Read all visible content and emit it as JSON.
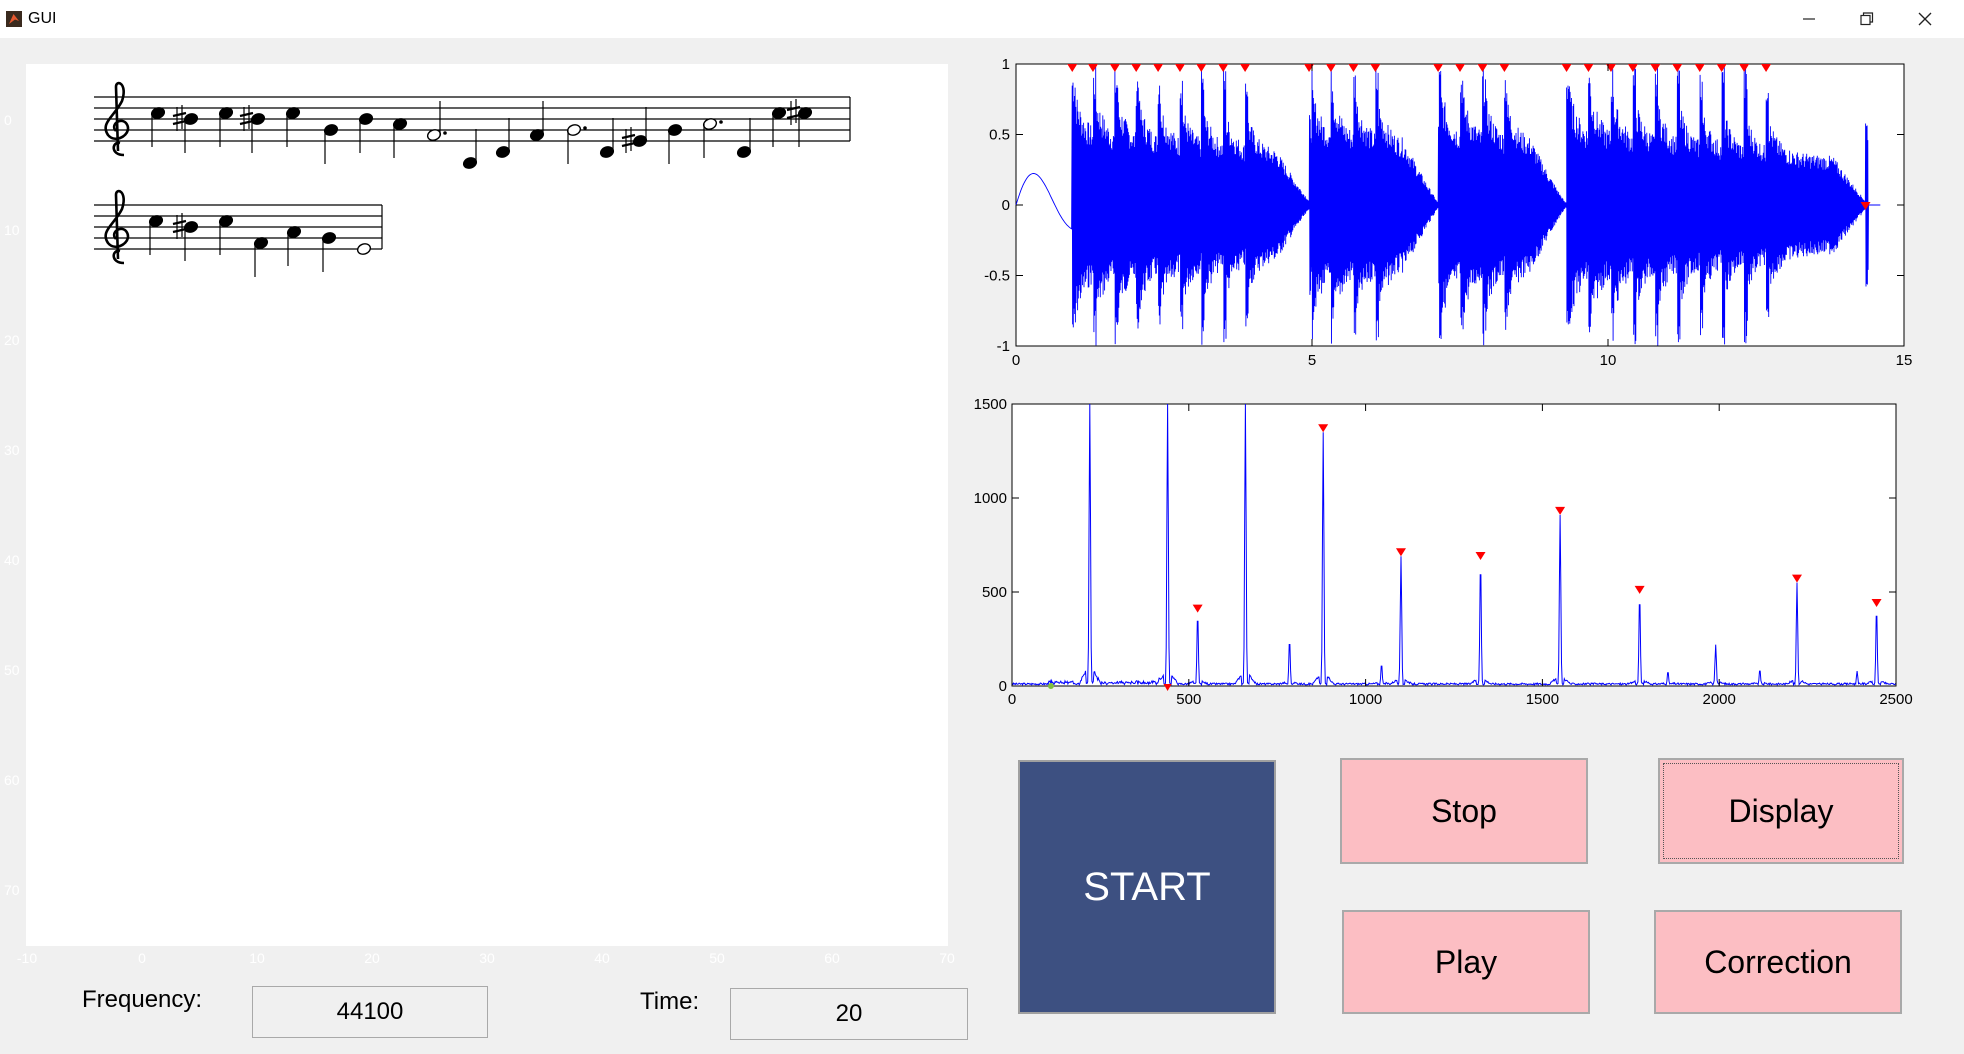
{
  "window": {
    "title": "GUI",
    "controls": {
      "minimize": "minimize-icon",
      "restore": "restore-icon",
      "close": "close-icon"
    }
  },
  "score": {
    "staff_rows": 2,
    "y_ticks": [
      "0",
      "10",
      "20",
      "30",
      "40",
      "50",
      "60",
      "70"
    ],
    "x_ticks": [
      "-10",
      "0",
      "10",
      "20",
      "30",
      "40",
      "50",
      "60",
      "70"
    ]
  },
  "fields": {
    "frequency_label": "Frequency:",
    "frequency_value": "44100",
    "time_label": "Time:",
    "time_value": "20"
  },
  "buttons": {
    "start": "START",
    "stop": "Stop",
    "display": "Display",
    "play": "Play",
    "correction": "Correction"
  },
  "colors": {
    "signal": "#0000ff",
    "marker": "#ff0000",
    "start_button": "#3d5081",
    "action_buttons": "#fcbec3"
  },
  "chart_data": [
    {
      "type": "line",
      "xlim": [
        0,
        15
      ],
      "ylim": [
        -1,
        1
      ],
      "x_ticks": [
        "0",
        "5",
        "10",
        "15"
      ],
      "y_ticks": [
        "1",
        "0.5",
        "0",
        "-0.5",
        "-1"
      ],
      "note_onsets": [
        0.95,
        1.3,
        1.67,
        2.03,
        2.4,
        2.77,
        3.13,
        3.5,
        3.87,
        4.95,
        5.32,
        5.7,
        6.07,
        7.13,
        7.5,
        7.88,
        8.25,
        9.3,
        9.67,
        10.05,
        10.42,
        10.8,
        11.17,
        11.55,
        11.92,
        12.3,
        12.67,
        14.35
      ],
      "segments": [
        {
          "start": 0.95,
          "end": 5.0
        },
        {
          "start": 5.0,
          "end": 7.15
        },
        {
          "start": 7.15,
          "end": 9.3
        },
        {
          "start": 9.3,
          "end": 14.4
        }
      ]
    },
    {
      "type": "line",
      "xlim": [
        0,
        2500
      ],
      "ylim": [
        0,
        1500
      ],
      "x_ticks": [
        "0",
        "500",
        "1000",
        "1500",
        "2000",
        "2500"
      ],
      "y_ticks": [
        "1500",
        "1000",
        "500",
        "0"
      ],
      "peaks": [
        {
          "x": 220,
          "y": 1500,
          "marked": false
        },
        {
          "x": 440,
          "y": 1500,
          "marked": false
        },
        {
          "x": 660,
          "y": 1500,
          "marked": false
        },
        {
          "x": 525,
          "y": 390,
          "marked": true
        },
        {
          "x": 880,
          "y": 1350,
          "marked": true
        },
        {
          "x": 1100,
          "y": 690,
          "marked": true
        },
        {
          "x": 1325,
          "y": 670,
          "marked": true
        },
        {
          "x": 1550,
          "y": 910,
          "marked": true
        },
        {
          "x": 1775,
          "y": 490,
          "marked": true
        },
        {
          "x": 2220,
          "y": 550,
          "marked": true
        },
        {
          "x": 2445,
          "y": 420,
          "marked": true
        }
      ],
      "minor_peaks": [
        {
          "x": 220,
          "y": 380
        },
        {
          "x": 785,
          "y": 250
        },
        {
          "x": 1045,
          "y": 120
        },
        {
          "x": 1990,
          "y": 220
        },
        {
          "x": 1855,
          "y": 80
        },
        {
          "x": 2115,
          "y": 90
        },
        {
          "x": 2390,
          "y": 80
        }
      ]
    }
  ]
}
